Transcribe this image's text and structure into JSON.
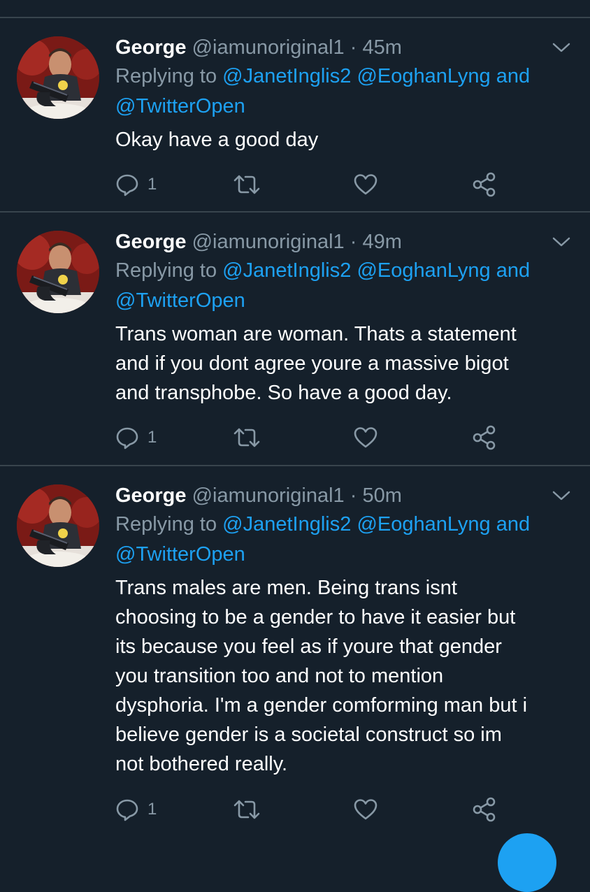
{
  "colors": {
    "background": "#15202b",
    "divider": "#38444d",
    "secondary_text": "#8899a6",
    "mention": "#1da1f2",
    "primary_text": "#ffffff"
  },
  "tweets": [
    {
      "name": "George",
      "handle": "@iamunoriginal1",
      "dot": "·",
      "time": "45m",
      "reply_prefix": "Replying to",
      "reply_mention_1": "@JanetInglis2",
      "reply_mention_2": "@EoghanLyng",
      "reply_and": "and",
      "reply_mention_3": "@TwitterOpen",
      "body_lines": [
        "Okay have a good day"
      ],
      "reply_count": "1"
    },
    {
      "name": "George",
      "handle": "@iamunoriginal1",
      "dot": "·",
      "time": "49m",
      "reply_prefix": "Replying to",
      "reply_mention_1": "@JanetInglis2",
      "reply_mention_2": "@EoghanLyng",
      "reply_and": "and",
      "reply_mention_3": "@TwitterOpen",
      "body_lines": [
        "Trans woman are woman. Thats a statement",
        "and if you dont agree youre a massive bigot",
        "and transphobe. So have a good day."
      ],
      "reply_count": "1"
    },
    {
      "name": "George",
      "handle": "@iamunoriginal1",
      "dot": "·",
      "time": "50m",
      "reply_prefix": "Replying to",
      "reply_mention_1": "@JanetInglis2",
      "reply_mention_2": "@EoghanLyng",
      "reply_and": "and",
      "reply_mention_3": "@TwitterOpen",
      "body_lines": [
        "Trans males are men. Being trans isnt",
        "choosing to be a gender to have it easier but",
        "its because you feel as if youre that gender",
        "you transition too and not to mention",
        "dysphoria. I'm a gender comforming man but i",
        "believe gender is a societal construct so im",
        "not bothered really."
      ],
      "reply_count": "1"
    }
  ],
  "icons": {
    "reply": "reply-icon",
    "retweet": "retweet-icon",
    "like": "heart-icon",
    "share": "share-icon",
    "menu": "chevron-down-icon"
  }
}
